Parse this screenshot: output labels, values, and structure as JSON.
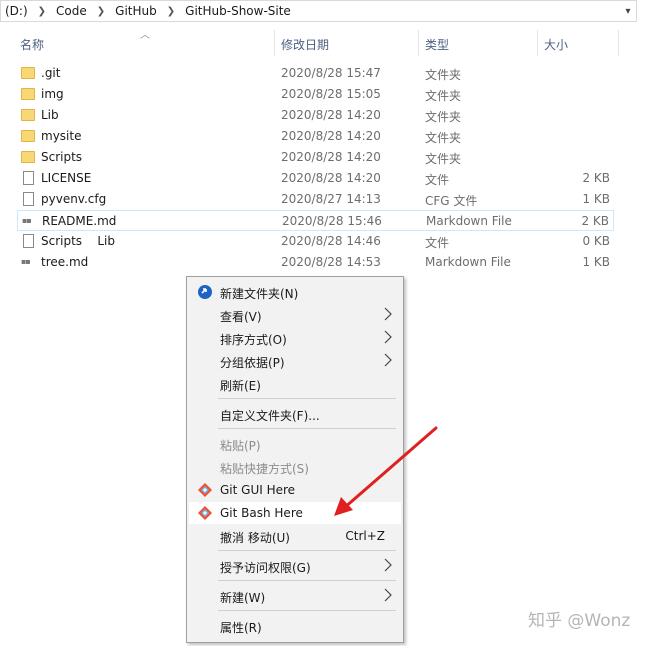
{
  "address": {
    "crumbs": [
      "(D:)",
      "Code",
      "GitHub",
      "GitHub-Show-Site"
    ]
  },
  "columns": {
    "name": "名称",
    "date": "修改日期",
    "type": "类型",
    "size": "大小"
  },
  "files": [
    {
      "name": ".git",
      "date": "2020/8/28 15:47",
      "type": "文件夹",
      "size": "",
      "icon": "folder-icon"
    },
    {
      "name": "img",
      "date": "2020/8/28 15:05",
      "type": "文件夹",
      "size": "",
      "icon": "folder-icon"
    },
    {
      "name": "Lib",
      "date": "2020/8/28 14:20",
      "type": "文件夹",
      "size": "",
      "icon": "folder-icon"
    },
    {
      "name": "mysite",
      "date": "2020/8/28 14:20",
      "type": "文件夹",
      "size": "",
      "icon": "folder-icon"
    },
    {
      "name": "Scripts",
      "date": "2020/8/28 14:20",
      "type": "文件夹",
      "size": "",
      "icon": "folder-icon"
    },
    {
      "name": "LICENSE",
      "date": "2020/8/28 14:20",
      "type": "文件",
      "size": "2 KB",
      "icon": "file-icon"
    },
    {
      "name": "pyvenv.cfg",
      "date": "2020/8/27 14:13",
      "type": "CFG 文件",
      "size": "1 KB",
      "icon": "file-icon"
    },
    {
      "name": "README.md",
      "date": "2020/8/28 15:46",
      "type": "Markdown File",
      "size": "2 KB",
      "icon": "markdown-file-icon"
    },
    {
      "name": "Scripts    Lib",
      "date": "2020/8/28 14:46",
      "type": "文件",
      "size": "0 KB",
      "icon": "file-icon"
    },
    {
      "name": "tree.md",
      "date": "2020/8/28 14:53",
      "type": "Markdown File",
      "size": "1 KB",
      "icon": "markdown-file-icon"
    }
  ],
  "menu": {
    "new_folder": "新建文件夹(N)",
    "view": "查看(V)",
    "sort": "排序方式(O)",
    "group": "分组依据(P)",
    "refresh": "刷新(E)",
    "customize": "自定义文件夹(F)...",
    "paste": "粘贴(P)",
    "paste_shortcut": "粘贴快捷方式(S)",
    "git_gui": "Git GUI Here",
    "git_bash": "Git Bash Here",
    "undo": "撤消 移动(U)",
    "undo_shortcut": "Ctrl+Z",
    "grant_access": "授予访问权限(G)",
    "new": "新建(W)",
    "properties": "属性(R)"
  },
  "watermark": "知乎 @Wonz",
  "colors": {
    "folder": "#f8d775",
    "highlight_border": "#cce8ff",
    "annotation_arrow": "#e02020",
    "git_icon": "#f05133"
  }
}
